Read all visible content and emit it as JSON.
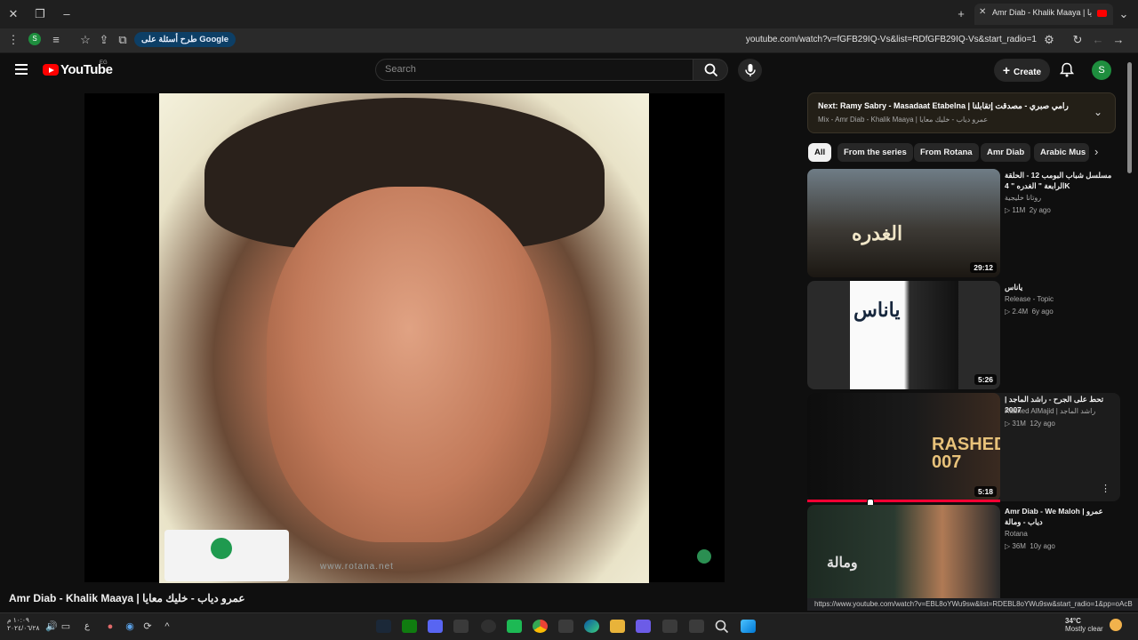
{
  "browser": {
    "tab_title": "Amr Diab - Khalik Maaya | خليك معايا",
    "google_pill": "طرح أسئلة على Google",
    "url": "youtube.com/watch?v=fGFB29IQ-Vs&list=RDfGFB29IQ-Vs&start_radio=1"
  },
  "youtube": {
    "logo": "YouTube",
    "country": "EG",
    "search_placeholder": "Search",
    "create_label": "Create",
    "avatar_letter": "S"
  },
  "video": {
    "title": "Amr Diab - Khalik Maaya | عمرو دياب - خليك معايا",
    "watermark_url": "www.rotana.net"
  },
  "playlist": {
    "next_title": "Next: Ramy Sabry - Masadaat Etabelna | رامي صبري - مصدقت إتقابلنا",
    "next_subtitle": "Mix - Amr Diab - Khalik Maaya | عمرو دياب - خليك معايا"
  },
  "chips": [
    "All",
    "From the series",
    "From Rotana",
    "Amr Diab",
    "Arabic Mus"
  ],
  "recommendations": [
    {
      "title": "مسلسل شباب البومب 12 - الحلقة الرابعة \" الغدره \" 4K",
      "channel": "روتانا خليجية",
      "views": "11M",
      "age": "2y ago",
      "duration": "29:12",
      "thumb_text": "الغدره"
    },
    {
      "title": "ياناس",
      "channel": "Release - Topic",
      "views": "2.4M",
      "age": "6y ago",
      "duration": "5:26",
      "thumb_text": "ياناس"
    },
    {
      "title": "تحط على الجرح - راشد الماجد | 2007",
      "channel": "Rashed AlMajid | راشد الماجد",
      "views": "31M",
      "age": "12y ago",
      "duration": "5:18",
      "thumb_text": "RASHED 007"
    },
    {
      "title": "Amr Diab - We Maloh | عمرو دياب - ومالة",
      "channel": "Rotana",
      "views": "36M",
      "age": "10y ago",
      "duration": "",
      "thumb_text": "ومالة"
    }
  ],
  "status_url": "https://www.youtube.com/watch?v=EBL8oYWu9sw&list=RDEBL8oYWu9sw&start_radio=1&pp=oAcB",
  "taskbar": {
    "time": "١٠:٠٩ م",
    "date": "٢٠٢٤/٠٦/٢٨",
    "temperature": "34°C",
    "weather": "Mostly clear",
    "lang": "ع"
  },
  "colors": {
    "brand_red": "#ff0000",
    "accent_green": "#1e8e3e",
    "progress_red": "#ff0033"
  }
}
